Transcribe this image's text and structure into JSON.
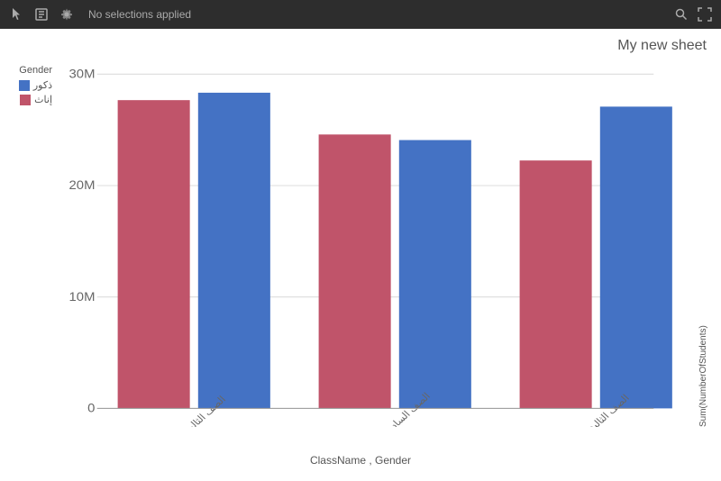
{
  "toolbar": {
    "status": "No selections applied",
    "icons": [
      "cursor-icon",
      "selection-icon",
      "gear-icon",
      "search-icon",
      "fullscreen-icon"
    ]
  },
  "sheet": {
    "title": "My new sheet"
  },
  "chart": {
    "legend_title": "Gender",
    "legend_items": [
      {
        "label": "ذكور",
        "color": "#4472c4"
      },
      {
        "label": "إناث",
        "color": "#c0546a"
      }
    ],
    "y_axis_label": "Sum(NumberOfStudents)",
    "x_axis_label": "ClassName , Gender",
    "y_ticks": [
      "30M",
      "20M",
      "10M",
      "0"
    ],
    "groups": [
      {
        "x_label": "الصف الثالث الابتدائي",
        "bars": [
          {
            "gender": "إناث",
            "value": 30.5,
            "color": "#c0546a"
          },
          {
            "gender": "ذكور",
            "value": 31.2,
            "color": "#4472c4"
          }
        ]
      },
      {
        "x_label": "الصف السادس الابتدائي",
        "bars": [
          {
            "gender": "إناث",
            "value": 27.0,
            "color": "#c0546a"
          },
          {
            "gender": "ذكور",
            "value": 26.5,
            "color": "#4472c4"
          }
        ]
      },
      {
        "x_label": "الصف الثالث المتوسط",
        "bars": [
          {
            "gender": "إناث",
            "value": 24.5,
            "color": "#c0546a"
          },
          {
            "gender": "ذكور",
            "value": 29.8,
            "color": "#4472c4"
          }
        ]
      }
    ],
    "max_value": 33
  }
}
